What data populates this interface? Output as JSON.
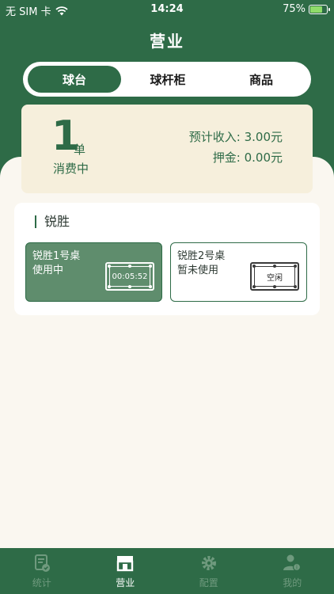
{
  "status_bar": {
    "carrier": "无 SIM 卡",
    "time": "14:24",
    "battery": "75%",
    "battery_level": 0.75,
    "wifi_icon": "wifi-icon",
    "battery_icon": "battery-charging-icon"
  },
  "header": {
    "title": "营业"
  },
  "tabs": [
    {
      "label": "球台",
      "active": true
    },
    {
      "label": "球杆柜",
      "active": false
    },
    {
      "label": "商品",
      "active": false
    }
  ],
  "summary": {
    "order_count": "1",
    "order_unit": "单",
    "order_label": "消费中",
    "income_text": "预计收入: 3.00元",
    "deposit_text": "押金: 0.00元"
  },
  "store": {
    "name": "锐胜",
    "tables": [
      {
        "name": "锐胜1号桌",
        "status": "使用中",
        "badge": "00:05:52",
        "state": "busy"
      },
      {
        "name": "锐胜2号桌",
        "status": "暂未使用",
        "badge": "空闲",
        "state": "free"
      }
    ]
  },
  "bottom_nav": [
    {
      "label": "统计",
      "icon": "stats-icon",
      "active": false
    },
    {
      "label": "营业",
      "icon": "store-icon",
      "active": true
    },
    {
      "label": "配置",
      "icon": "gear-icon",
      "active": false
    },
    {
      "label": "我的",
      "icon": "user-icon",
      "active": false
    }
  ],
  "colors": {
    "primary": "#2e6b47",
    "busy_card": "#5f8d6d",
    "summary_bg": "#f6efdc",
    "page_bg": "#faf7f0"
  }
}
